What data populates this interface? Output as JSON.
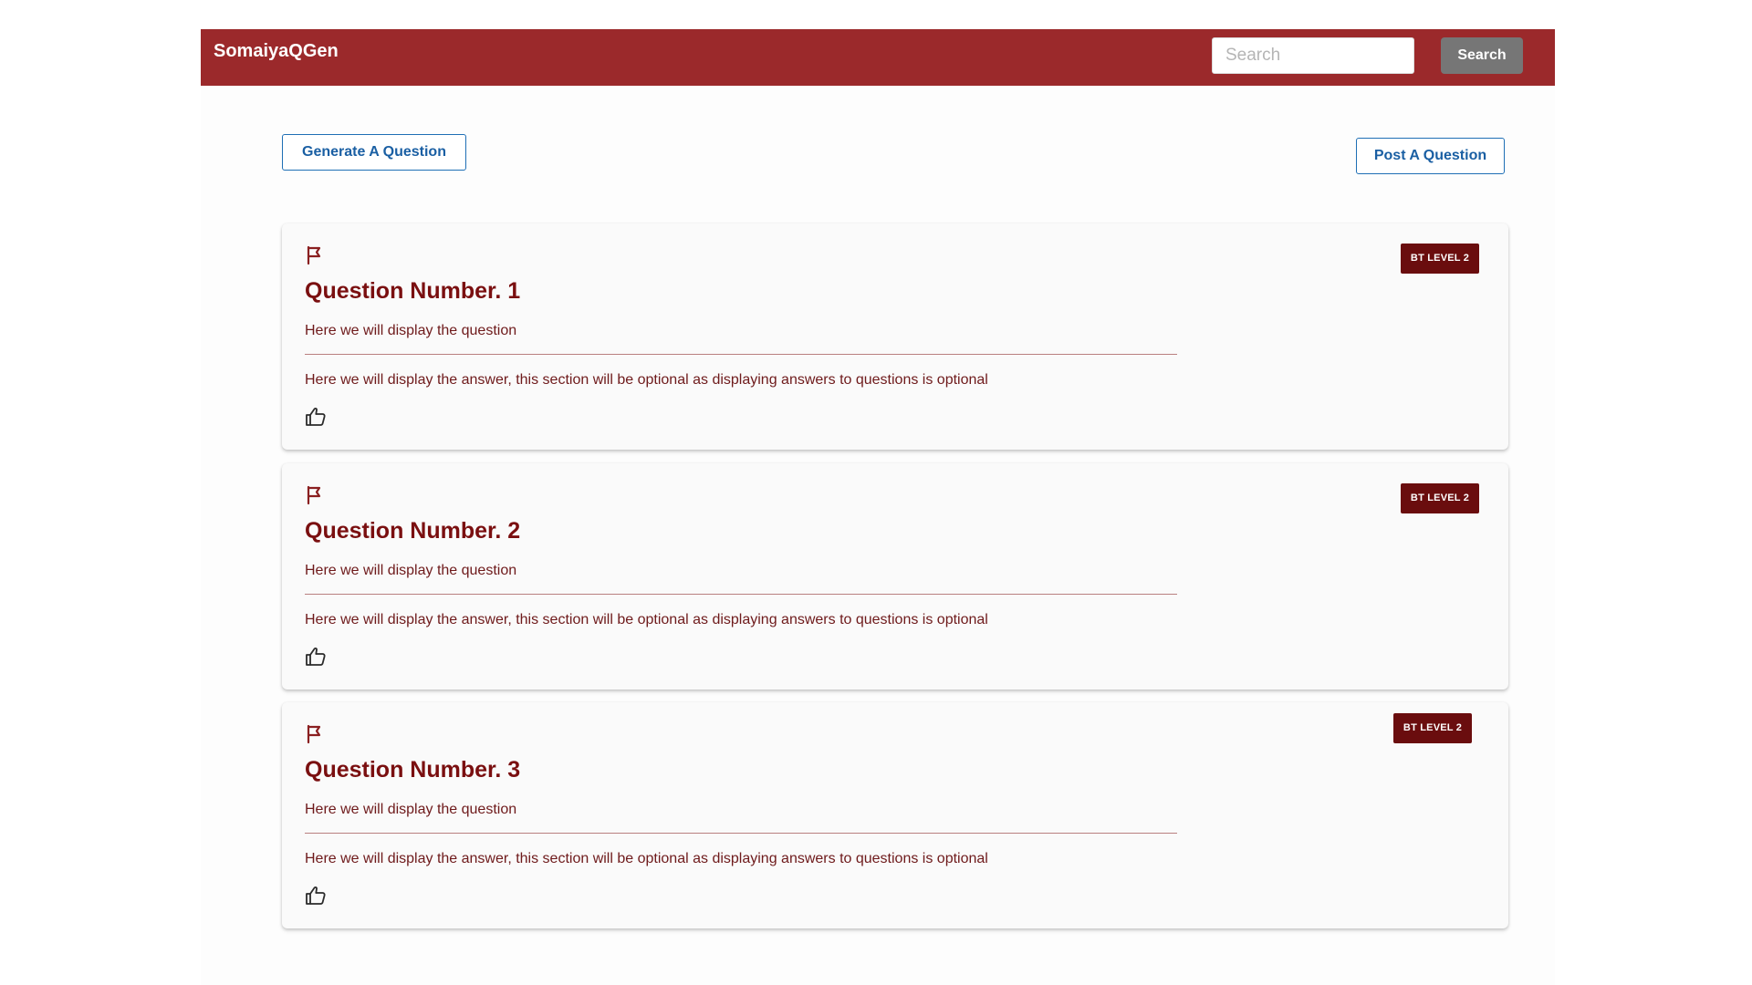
{
  "navbar": {
    "brand": "SomaiyaQGen",
    "search_placeholder": "Search",
    "search_value": "",
    "search_button": "Search"
  },
  "actions": {
    "generate_label": "Generate A Question",
    "post_label": "Post A Question"
  },
  "questions": [
    {
      "title": "Question Number. 1",
      "question": "Here we will display the question",
      "answer": "Here we will display the answer, this section will be optional as displaying answers to questions is optional",
      "badge": "BT LEVEL 2"
    },
    {
      "title": "Question Number. 2",
      "question": "Here we will display the question",
      "answer": "Here we will display the answer, this section will be optional as displaying answers to questions is optional",
      "badge": "BT LEVEL 2"
    },
    {
      "title": "Question Number. 3",
      "question": "Here we will display the question",
      "answer": "Here we will display the answer, this section will be optional as displaying answers to questions is optional",
      "badge": "BT LEVEL 2"
    }
  ],
  "icons": {
    "flag": "flag-icon",
    "like": "thumbs-up-icon"
  },
  "colors": {
    "navbar": "#9b292b",
    "title": "#7a0f10",
    "badge": "#6a0d0e",
    "outline_button": "#1f6fb5",
    "search_button": "#767676"
  }
}
